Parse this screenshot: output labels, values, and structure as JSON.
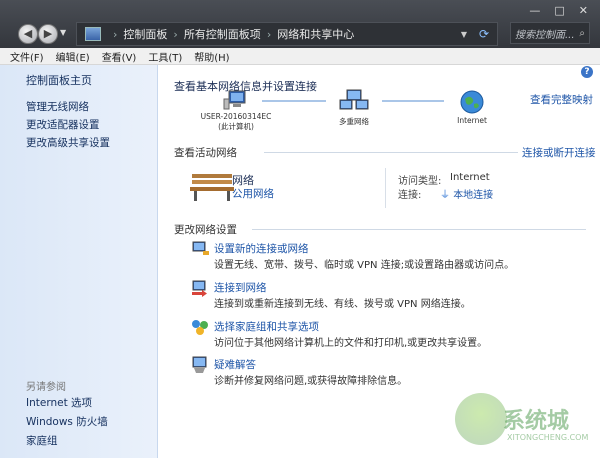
{
  "window": {
    "controls": [
      "—",
      "□",
      "✕"
    ],
    "nav": {
      "back_icon": "back-arrow-icon",
      "forward_icon": "forward-arrow-icon"
    },
    "address": [
      "控制面板",
      "所有控制面板项",
      "网络和共享中心"
    ],
    "search_placeholder": "搜索控制面..."
  },
  "menu": [
    "文件(F)",
    "编辑(E)",
    "查看(V)",
    "工具(T)",
    "帮助(H)"
  ],
  "sidebar": {
    "home": "控制面板主页",
    "links": [
      "管理无线网络",
      "更改适配器设置",
      "更改高级共享设置"
    ],
    "see_also_heading": "另请参阅",
    "see_also": [
      "Internet 选项",
      "Windows 防火墙",
      "家庭组"
    ]
  },
  "main": {
    "title": "查看基本网络信息并设置连接",
    "view_full_map": "查看完整映射",
    "nodes": [
      {
        "label_line1": "USER-20160314EC",
        "label_line2": "(此计算机)",
        "icon": "computer-icon"
      },
      {
        "label_line1": "多重网络",
        "label_line2": "",
        "icon": "network-icon"
      },
      {
        "label_line1": "Internet",
        "label_line2": "",
        "icon": "globe-icon"
      }
    ],
    "active_heading": "查看活动网络",
    "connect_toggle": "连接或断开连接",
    "network_name": "网络",
    "network_type": "公用网络",
    "access_type_label": "访问类型:",
    "access_type_value": "Internet",
    "connection_label": "连接:",
    "connection_value": "本地连接",
    "change_heading": "更改网络设置",
    "items": [
      {
        "title": "设置新的连接或网络",
        "desc": "设置无线、宽带、拨号、临时或 VPN 连接;或设置路由器或访问点。",
        "icon": "new-connection-icon"
      },
      {
        "title": "连接到网络",
        "desc": "连接到或重新连接到无线、有线、拨号或 VPN 网络连接。",
        "icon": "connect-network-icon"
      },
      {
        "title": "选择家庭组和共享选项",
        "desc": "访问位于其他网络计算机上的文件和打印机,或更改共享设置。",
        "icon": "homegroup-icon"
      },
      {
        "title": "疑难解答",
        "desc": "诊断并修复网络问题,或获得故障排除信息。",
        "icon": "troubleshoot-icon"
      }
    ]
  },
  "watermark": {
    "text": "系统城",
    "sub": "XITONGCHENG.COM"
  },
  "colors": {
    "link": "#1f56a8",
    "titlebar": "#3a3d43",
    "sidebar": "#dbe7f7"
  }
}
